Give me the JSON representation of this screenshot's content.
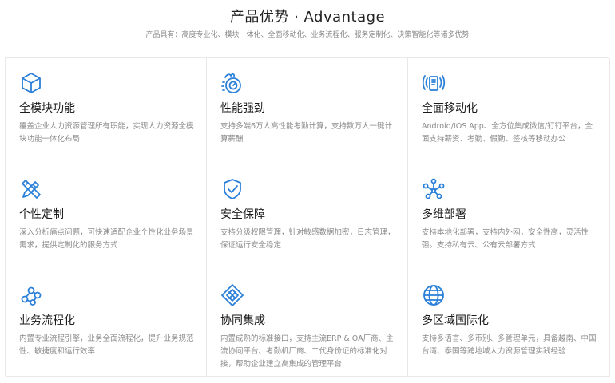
{
  "header": {
    "title": "产品优势 · Advantage",
    "subtitle": "产品具有：高度专业化、模块一体化、全面移动化、业务流程化、服务定制化、决策智能化等诸多优势"
  },
  "theme": {
    "accent": "#2a7fd9"
  },
  "features": [
    {
      "icon": "cube-icon",
      "title": "全模块功能",
      "desc": "覆盖企业人力资源管理所有职能，实现人力资源全模块功能一体化布局"
    },
    {
      "icon": "flame-gauge-icon",
      "title": "性能强劲",
      "desc": "支持多端6万人高性能考勤计算，支持数万人一键计算薪酬"
    },
    {
      "icon": "mobile-signal-icon",
      "title": "全面移动化",
      "desc": "Android/IOS App、全方位集成微信/钉钉平台，全面支持薪资、考勤、假勤、签核等移动办公"
    },
    {
      "icon": "design-tools-icon",
      "title": "个性定制",
      "desc": "深入分析痛点问题，可快速适配企业个性化业务场景需求，提供定制化的服务方式"
    },
    {
      "icon": "shield-check-icon",
      "title": "安全保障",
      "desc": "支持分级权限管理，针对敏感数据加密，日志管理，保证运行安全稳定"
    },
    {
      "icon": "network-nodes-icon",
      "title": "多维部署",
      "desc": "支持本地化部署，支持内外网，安全性高，灵活性强。支持私有云、公有云部署方式"
    },
    {
      "icon": "workflow-nodes-icon",
      "title": "业务流程化",
      "desc": "内置专业流程引擎，业务全面流程化，提升业务规范性、敏捷度和运行效率"
    },
    {
      "icon": "collaboration-icon",
      "title": "协同集成",
      "desc": "内置成熟的标准接口，支持主流ERP & OA厂商、主流协同平台、考勤机厂商、二代身份证的标准化对接，帮助企业建立高集成的管理平台"
    },
    {
      "icon": "globe-icon",
      "title": "多区域国际化",
      "desc": "支持多语言、多币别、多管理单元，具备越南、中国台湾、泰国等跨地域人力资源管理实践经验"
    }
  ]
}
